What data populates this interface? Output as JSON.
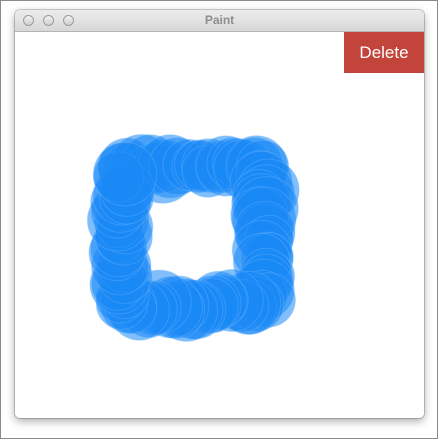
{
  "window": {
    "title": "Paint"
  },
  "toolbar": {
    "delete_label": "Delete"
  },
  "drawing": {
    "brush_color": "#1a88f5",
    "shape": "square-loop"
  }
}
